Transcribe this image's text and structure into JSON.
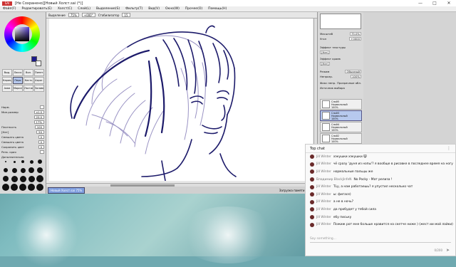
{
  "app": {
    "logo_text": "SAI",
    "title": "[Не Сохранено][Новый Холст.sai (*)]",
    "window_minimize": "—",
    "window_maximize": "□",
    "window_close": "✕"
  },
  "menu": [
    "Файл(F)",
    "Редактировать(E)",
    "Холст(C)",
    "Слой(L)",
    "Выделение(S)",
    "Фильтр(T)",
    "Вид(V)",
    "Окно(W)",
    "Прочее(O)",
    "Помощь(H)"
  ],
  "toolbar": {
    "select_label": "Выделение",
    "zoom_value": "75%",
    "rotate_value": "+000°",
    "straighten_label": "Стабилизатор",
    "stabilizer_value": "15"
  },
  "left_panel": {
    "tools": [
      "Выд.",
      "Лассо",
      "Вол.",
      "Пипет.",
      "Карандаш",
      "Перо",
      "Кисть",
      "Аэрог.",
      "Аква",
      "Маркер",
      "Ластик",
      "Заливка"
    ],
    "selected_tool": 5,
    "options": [
      {
        "label": "Норм.",
        "value": ""
      },
      {
        "label": "Мин.размер",
        "value": "x1.0"
      },
      {
        "label": "",
        "value": "20.0"
      },
      {
        "label": "",
        "value": "17%"
      },
      {
        "label": "Плотность",
        "value": "100"
      },
      {
        "label": "[Нет]",
        "value": "50"
      },
      {
        "label": "Смешать цвета",
        "value": "0"
      },
      {
        "label": "Смешать цвета",
        "value": "0"
      },
      {
        "label": "Сохранить цвет",
        "value": "0"
      },
      {
        "label": "Резк. края",
        "value": ""
      }
    ],
    "advanced_label": "Дополнительно"
  },
  "canvas": {
    "tab_label": "Новый Холст.sai",
    "tab_zoom": "75%",
    "status_text": "Загрузка памяти: 51%"
  },
  "right_panel": {
    "zoom_label": "Масштаб",
    "zoom_value": "75.0%",
    "angle_label": "Угол",
    "angle_value": "+0000",
    "rows": [
      {
        "label": "Эффект текстуры",
        "value": ""
      },
      {
        "label": "[Нет]",
        "value": ""
      },
      {
        "label": "Эффект краев",
        "value": ""
      },
      {
        "label": "[Нет]",
        "value": ""
      },
      {
        "label": "Режим",
        "value": "Обычный"
      },
      {
        "label": "Непрозр.",
        "value": "100%"
      }
    ],
    "checks": [
      "Фикс непр.",
      "Прозрачные обл.",
      "Источник выбора"
    ],
    "layers": [
      {
        "name": "Слой5",
        "mode": "Нормальный",
        "opacity": "100%",
        "selected": false
      },
      {
        "name": "Слой3",
        "mode": "Нормальный",
        "opacity": "100%",
        "selected": true
      },
      {
        "name": "Слой4",
        "mode": "Нормальный",
        "opacity": "100%",
        "selected": false
      },
      {
        "name": "Слой2",
        "mode": "Нормальный",
        "opacity": "100%",
        "selected": false
      },
      {
        "name": "Слой1",
        "mode": "Нормальный",
        "opacity": "100%",
        "selected": false
      }
    ]
  },
  "chat": {
    "header": "Top chat",
    "messages": [
      {
        "author": "Jill Winter",
        "text": "хэкушки хэкушки 😸"
      },
      {
        "author": "Jill Winter",
        "text": "чё сразу 'дуня из нопы'? я вообще в рисовке в последнее время на ногу"
      },
      {
        "author": "Jill Winter",
        "text": "нормальные пальцы же"
      },
      {
        "author": "Владимир BlackJinfeN",
        "text": "No Pocky - Мат релиза !"
      },
      {
        "author": "Jill Winter",
        "text": "ТLу, а нам работаешь? я упустил несколько чат"
      },
      {
        "author": "Jill Winter",
        "text": "ы: фигасе)"
      },
      {
        "author": "Jill Winter",
        "text": "а не в ночь?"
      },
      {
        "author": "Jill Winter",
        "text": "да пробудет у тебой сила"
      },
      {
        "author": "Jill Winter",
        "text": "ебу письку"
      },
      {
        "author": "Jill Winter",
        "text": "Пожиж рот мне больше нравится на скетче ниже ) (жест ии мой лайки)"
      }
    ],
    "input_placeholder": "Say something...",
    "char_count": "0/200"
  }
}
